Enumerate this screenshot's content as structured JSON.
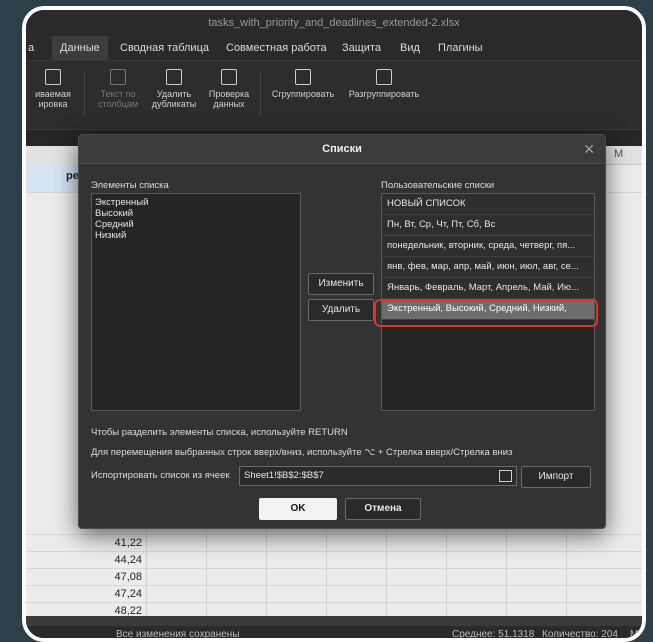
{
  "window": {
    "title": "tasks_with_priority_and_deadlines_extended-2.xlsx"
  },
  "menu": {
    "items": [
      "а",
      "Данные",
      "Сводная таблица",
      "Совместная работа",
      "Защита",
      "Вид",
      "Плагины"
    ],
    "active": "Данные"
  },
  "toolbar": {
    "b1": "иваемая\nировка",
    "b2": "Текст по\nстолбцам",
    "b3": "Удалить\nдубликаты",
    "b4": "Проверка\nданных",
    "b5": "Сгруппировать",
    "b6": "Разгруппировать"
  },
  "sheet": {
    "header_partial": "ре",
    "col_m": "M",
    "values": [
      "41,22",
      "44,24",
      "47,08",
      "47,24",
      "48,22"
    ]
  },
  "dialog": {
    "title": "Списки",
    "list_items_label": "Элементы списка",
    "list_items": [
      "Экстренный",
      "Высокий",
      "Средний",
      "Низкий"
    ],
    "custom_lists_label": "Пользовательские списки",
    "custom_lists": [
      "НОВЫЙ СПИСОК",
      "Пн, Вт, Ср, Чт, Пт, Сб, Вс",
      "понедельник, вторник, среда, четверг, пя...",
      "янв, фев, мар, апр, май, июн, июл, авг, се...",
      "Январь, Февраль, Март, Апрель, Май, Ию...",
      "Экстренный, Высокий, Средний, Низкий,"
    ],
    "selected_index": 5,
    "change_label": "Изменить",
    "delete_label": "Удалить",
    "hint1": "Чтобы разделить элементы списка, используйте RETURN",
    "hint2": "Для перемещения выбранных строк вверх/вниз, используйте ⌥ + Стрелка вверх/Стрелка вниз",
    "import_label": "Испортировать список из ячеек",
    "import_value": "Sheet1!$B$2:$B$7",
    "import_button": "Импорт",
    "ok_label": "OK",
    "cancel_label": "Отмена"
  },
  "status": {
    "saved": "Все изменения сохранены",
    "average": "Среднее: 51,1318",
    "count": "Количество: 204",
    "extra": "М"
  },
  "colors": {
    "highlight": "#e0322b",
    "selected": "#6d6d6d"
  }
}
